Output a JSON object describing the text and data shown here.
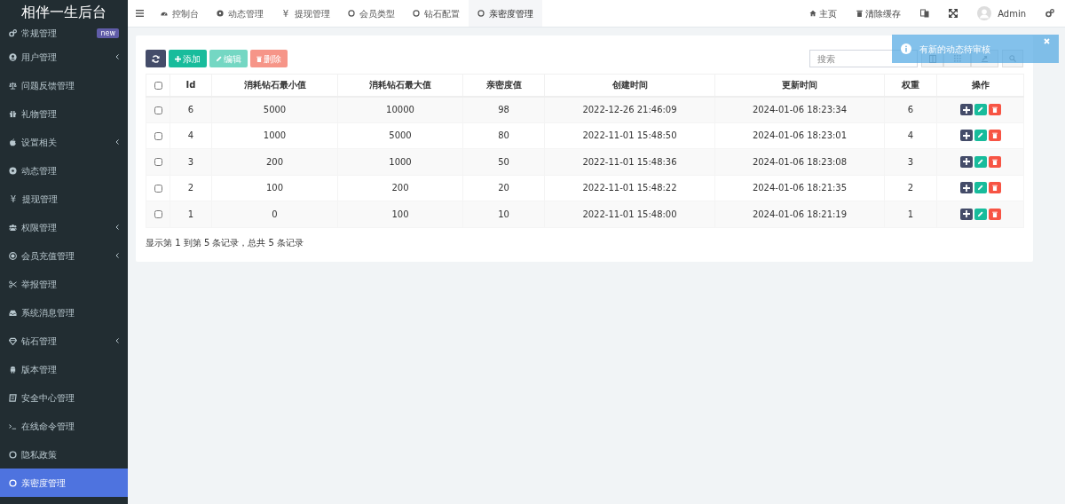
{
  "app": {
    "title": "相伴一生后台"
  },
  "sidebar": {
    "items": [
      {
        "label": "常规管理",
        "badge": "new",
        "expandable": false,
        "selected": false
      },
      {
        "label": "用户管理",
        "expandable": true,
        "selected": false
      },
      {
        "label": "问题反馈管理",
        "expandable": false,
        "selected": false
      },
      {
        "label": "礼物管理",
        "expandable": false,
        "selected": false
      },
      {
        "label": "设置相关",
        "expandable": true,
        "selected": false
      },
      {
        "label": "动态管理",
        "expandable": false,
        "selected": false
      },
      {
        "label": "提现管理",
        "icon_char": "¥",
        "expandable": false,
        "selected": false
      },
      {
        "label": "权限管理",
        "expandable": true,
        "selected": false
      },
      {
        "label": "会员充值管理",
        "expandable": true,
        "selected": false
      },
      {
        "label": "举报管理",
        "expandable": false,
        "selected": false
      },
      {
        "label": "系统消息管理",
        "expandable": false,
        "selected": false
      },
      {
        "label": "钻石管理",
        "expandable": true,
        "selected": false
      },
      {
        "label": "版本管理",
        "expandable": false,
        "selected": false
      },
      {
        "label": "安全中心管理",
        "expandable": false,
        "selected": false
      },
      {
        "label": "在线命令管理",
        "expandable": false,
        "selected": false
      },
      {
        "label": "隐私政策",
        "expandable": false,
        "selected": false
      },
      {
        "label": "亲密度管理",
        "expandable": false,
        "selected": true
      }
    ]
  },
  "tabs": [
    {
      "label": "控制台",
      "selected": false
    },
    {
      "label": "动态管理",
      "selected": false
    },
    {
      "label": "提现管理",
      "icon_char": "¥",
      "selected": false
    },
    {
      "label": "会员类型",
      "selected": false
    },
    {
      "label": "钻石配置",
      "selected": false
    },
    {
      "label": "亲密度管理",
      "selected": true
    }
  ],
  "header_right": {
    "home": "主页",
    "clear_cache": "清除缓存",
    "user": "Admin"
  },
  "toolbar": {
    "add": "添加",
    "edit": "编辑",
    "delete": "删除",
    "search_placeholder": "搜索"
  },
  "toast": {
    "message": "有新的动态待审核"
  },
  "table": {
    "all_checked": false,
    "columns": [
      "Id",
      "消耗钻石最小值",
      "消耗钻石最大值",
      "亲密度值",
      "创建时间",
      "更新时间",
      "权重",
      "操作"
    ],
    "rows": [
      {
        "checked": false,
        "cells": [
          "6",
          "5000",
          "10000",
          "98",
          "2022-12-26 21:46:09",
          "2024-01-06 18:23:34",
          "6"
        ]
      },
      {
        "checked": false,
        "cells": [
          "4",
          "1000",
          "5000",
          "80",
          "2022-11-01 15:48:50",
          "2024-01-06 18:23:01",
          "4"
        ]
      },
      {
        "checked": false,
        "cells": [
          "3",
          "200",
          "1000",
          "50",
          "2022-11-01 15:48:36",
          "2024-01-06 18:23:08",
          "3"
        ]
      },
      {
        "checked": false,
        "cells": [
          "2",
          "100",
          "200",
          "20",
          "2022-11-01 15:48:22",
          "2024-01-06 18:21:35",
          "2"
        ]
      },
      {
        "checked": false,
        "cells": [
          "1",
          "0",
          "100",
          "10",
          "2022-11-01 15:48:00",
          "2024-01-06 18:21:19",
          "1"
        ]
      }
    ]
  },
  "pagination_info": "显示第 1 到第 5 条记录，总共 5 条记录"
}
